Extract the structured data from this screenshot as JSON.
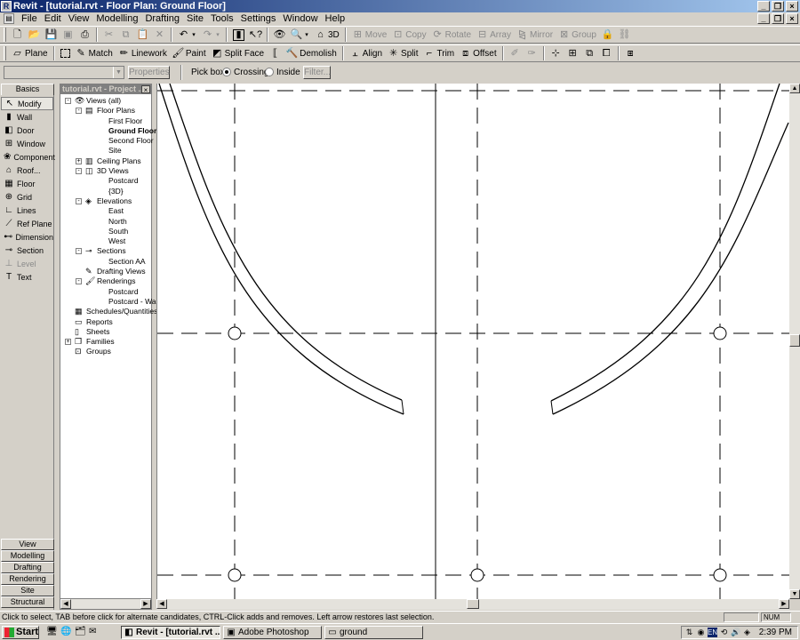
{
  "window": {
    "title": "Revit - [tutorial.rvt - Floor Plan: Ground Floor]"
  },
  "menu": [
    "File",
    "Edit",
    "View",
    "Modelling",
    "Drafting",
    "Site",
    "Tools",
    "Settings",
    "Window",
    "Help"
  ],
  "toolbar_top": {
    "view_3d_label": "3D",
    "move": "Move",
    "copy": "Copy",
    "rotate": "Rotate",
    "array": "Array",
    "mirror": "Mirror",
    "group": "Group"
  },
  "toolbar_edit": {
    "plane": "Plane",
    "match": "Match",
    "linework": "Linework",
    "paint": "Paint",
    "split_face": "Split Face",
    "demolish": "Demolish",
    "align": "Align",
    "split": "Split",
    "trim": "Trim",
    "offset": "Offset"
  },
  "options_bar": {
    "type_selector_value": "",
    "properties_label": "Properties",
    "pick_box_label": "Pick box:",
    "crossing_label": "Crossing",
    "inside_label": "Inside",
    "filter_label": "Filter...",
    "pick_box_selected": "Crossing"
  },
  "design_bar": {
    "active_tab": "Basics",
    "tools": [
      "Modify",
      "Wall",
      "Door",
      "Window",
      "Component",
      "Roof...",
      "Floor",
      "Grid",
      "Lines",
      "Ref Plane",
      "Dimension",
      "Section",
      "Level",
      "Text"
    ],
    "active_tool": "Modify",
    "disabled_tools": [
      "Level"
    ],
    "bottom_tabs": [
      "View",
      "Modelling",
      "Drafting",
      "Rendering",
      "Site",
      "Structural"
    ]
  },
  "project_browser": {
    "title": "tutorial.rvt - Project ...",
    "tree": [
      {
        "label": "Views (all)",
        "level": 0,
        "toggle": "-",
        "icon": "eye-icon"
      },
      {
        "label": "Floor Plans",
        "level": 1,
        "toggle": "-",
        "icon": "floor-plan-icon"
      },
      {
        "label": "First Floor",
        "level": 2
      },
      {
        "label": "Ground Floor",
        "level": 2,
        "bold": true
      },
      {
        "label": "Second Floor",
        "level": 2
      },
      {
        "label": "Site",
        "level": 2
      },
      {
        "label": "Ceiling Plans",
        "level": 1,
        "toggle": "+",
        "icon": "ceiling-plan-icon"
      },
      {
        "label": "3D Views",
        "level": 1,
        "toggle": "-",
        "icon": "cube-icon"
      },
      {
        "label": "Postcard",
        "level": 2
      },
      {
        "label": "{3D}",
        "level": 2
      },
      {
        "label": "Elevations",
        "level": 1,
        "toggle": "-",
        "icon": "elevation-icon"
      },
      {
        "label": "East",
        "level": 2
      },
      {
        "label": "North",
        "level": 2
      },
      {
        "label": "South",
        "level": 2
      },
      {
        "label": "West",
        "level": 2
      },
      {
        "label": "Sections",
        "level": 1,
        "toggle": "-",
        "icon": "section-icon"
      },
      {
        "label": "Section AA",
        "level": 2
      },
      {
        "label": "Drafting Views",
        "level": 1,
        "icon": "drafting-icon"
      },
      {
        "label": "Renderings",
        "level": 1,
        "toggle": "-",
        "icon": "rendering-icon"
      },
      {
        "label": "Postcard",
        "level": 2
      },
      {
        "label": "Postcard - Wall",
        "level": 2
      },
      {
        "label": "Schedules/Quantities",
        "level": 0,
        "icon": "schedule-icon"
      },
      {
        "label": "Reports",
        "level": 0,
        "icon": "report-icon"
      },
      {
        "label": "Sheets",
        "level": 0,
        "icon": "sheet-icon"
      },
      {
        "label": "Families",
        "level": 0,
        "toggle": "+",
        "icon": "family-icon"
      },
      {
        "label": "Groups",
        "level": 0,
        "icon": "group-icon"
      }
    ]
  },
  "status": {
    "message": "Click to select, TAB before click for alternate candidates, CTRL-Click adds and removes. Left arrow restores last selection.",
    "num": "NUM"
  },
  "taskbar": {
    "start": "Start",
    "tasks": [
      {
        "label": "Revit - [tutorial.rvt ...",
        "active": true,
        "icon": "revit-icon"
      },
      {
        "label": "Adobe Photoshop",
        "active": false,
        "icon": "photoshop-icon"
      },
      {
        "label": "ground",
        "active": false,
        "icon": "folder-icon"
      }
    ],
    "tray_lang": "EN",
    "clock": "2:39 PM"
  }
}
